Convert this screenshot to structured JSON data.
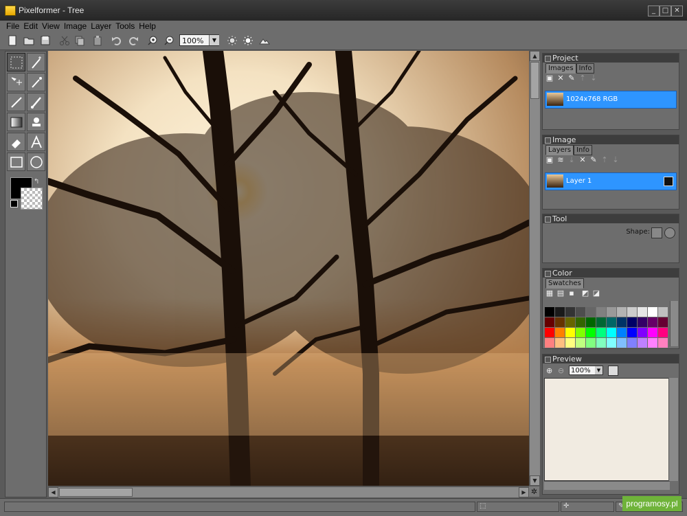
{
  "window": {
    "app_name": "Pixelformer",
    "title": "Pixelformer - Tree"
  },
  "menu": [
    {
      "label": "File"
    },
    {
      "label": "Edit"
    },
    {
      "label": "View"
    },
    {
      "label": "Image"
    },
    {
      "label": "Layer"
    },
    {
      "label": "Tools"
    },
    {
      "label": "Help"
    }
  ],
  "toolbar": {
    "zoom_value": "100%"
  },
  "panels": {
    "project": {
      "title": "Project",
      "tabs": [
        "Images",
        "Info"
      ],
      "active_tab": "Images",
      "items": [
        {
          "label": "1024x768 RGB"
        }
      ]
    },
    "image": {
      "title": "Image",
      "tabs": [
        "Layers",
        "Info"
      ],
      "active_tab": "Layers",
      "items": [
        {
          "label": "Layer 1"
        }
      ]
    },
    "tool": {
      "title": "Tool",
      "shape_label": "Shape:"
    },
    "color": {
      "title": "Color",
      "tabs": [
        "Swatches"
      ],
      "active_tab": "Swatches",
      "swatches": [
        "#000000",
        "#1a1a1a",
        "#333333",
        "#4d4d4d",
        "#666666",
        "#808080",
        "#999999",
        "#b3b3b3",
        "#cccccc",
        "#e6e6e6",
        "#ffffff",
        "#bfbfbf",
        "#660000",
        "#663300",
        "#666600",
        "#336600",
        "#006600",
        "#006633",
        "#006666",
        "#003366",
        "#000066",
        "#330066",
        "#660066",
        "#660033",
        "#ff0000",
        "#ff8000",
        "#ffff00",
        "#80ff00",
        "#00ff00",
        "#00ff80",
        "#00ffff",
        "#0080ff",
        "#0000ff",
        "#8000ff",
        "#ff00ff",
        "#ff0080",
        "#ff8080",
        "#ffbf80",
        "#ffff80",
        "#bfff80",
        "#80ff80",
        "#80ffbf",
        "#80ffff",
        "#80bfff",
        "#8080ff",
        "#bf80ff",
        "#ff80ff",
        "#ff80bf"
      ]
    },
    "preview": {
      "title": "Preview",
      "zoom_value": "100%"
    }
  },
  "watermark": "programosy.pl",
  "colors": {
    "selection": "#2e95ff",
    "panel_bg": "#6d6d6d",
    "header_bg": "#3d3d3d"
  }
}
